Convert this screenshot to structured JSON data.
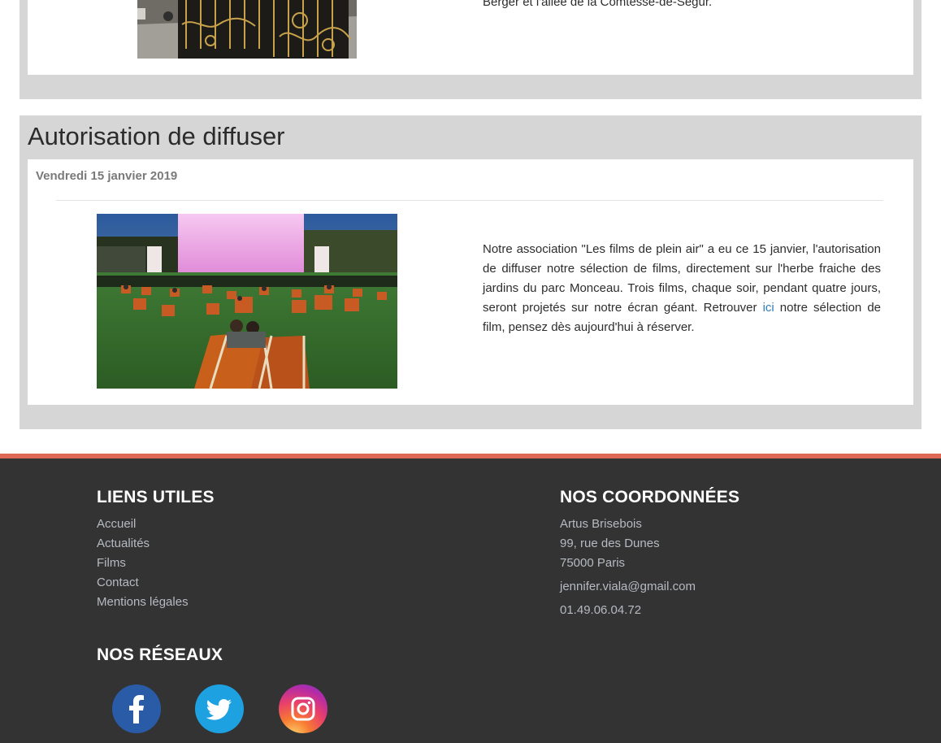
{
  "article_prev": {
    "text_tail": "Berger et l'allée de la Comtesse-de-Ségur."
  },
  "article": {
    "title": "Autorisation de diffuser",
    "date": "Vendredi 15 janvier 2019",
    "text_before": "Notre association \"Les films de plein air\" a eu ce 15 janvier, l'autorisation de diffuser notre sélection de films, directement sur l'herbe fraiche des jardins du parc Monceau. Trois films, chaque soir, pendant quatre jours, seront projetés sur notre écran géant. Retrouver ",
    "link_label": "ici",
    "text_after": " notre sélection de film, pensez dès aujourd'hui à réserver."
  },
  "footer": {
    "links_heading": "LIENS UTILES",
    "links": [
      "Accueil",
      "Actualités",
      "Films",
      "Contact",
      "Mentions légales"
    ],
    "contact_heading": "NOS COORDONNÉES",
    "contact_name": "Artus Brisebois",
    "contact_street": "99, rue des Dunes",
    "contact_city": "75000 Paris",
    "contact_email": "jennifer.viala@gmail.com",
    "contact_phone": "01.49.06.04.72",
    "social_heading": "NOS RÉSEAUX",
    "social_icons": [
      "facebook-icon",
      "twitter-icon",
      "instagram-icon"
    ]
  },
  "colors": {
    "footer_bg": "#333333",
    "footer_accent": "#e06754",
    "link": "#2f7fbf",
    "card_bg": "#d6d6d6"
  }
}
